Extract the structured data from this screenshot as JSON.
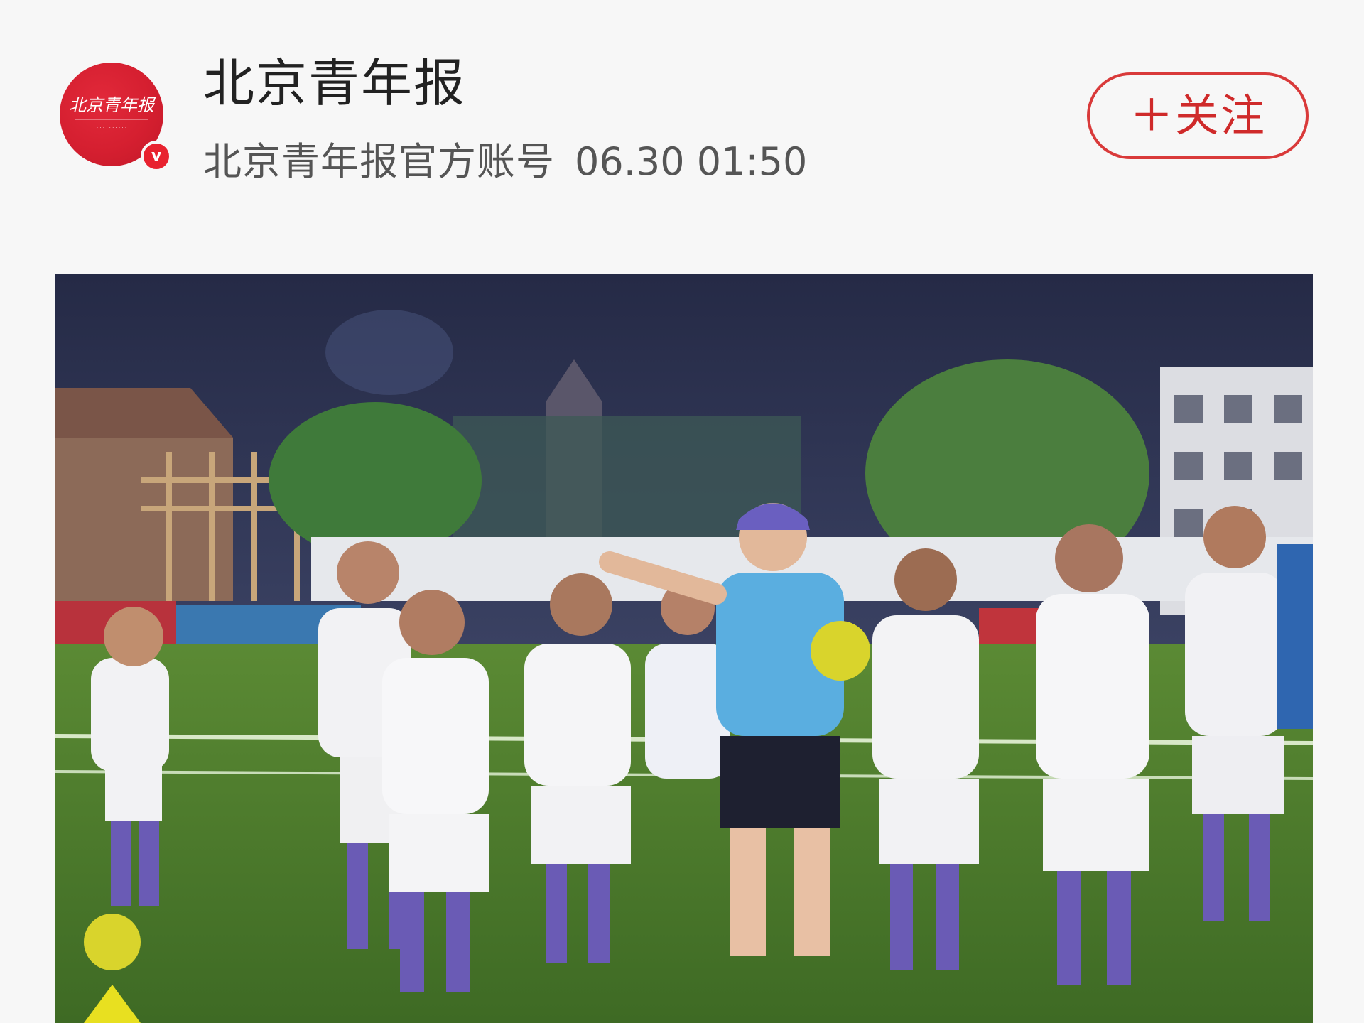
{
  "header": {
    "avatar": {
      "icon": "newspaper-logo-icon",
      "logo_text": "北京青年报",
      "color": "#d51f30"
    },
    "verified_badge": {
      "label": "v",
      "color": "#e8222f"
    },
    "account_name": "北京青年报",
    "account_desc": "北京青年报官方账号",
    "timestamp": "06.30 01:50",
    "follow_button": {
      "label": "＋关注",
      "color": "#cf2a2a"
    }
  },
  "article": {
    "photo": {
      "icon": "photo-youth-football-team-coach",
      "colors": {
        "sky": "#2b3151",
        "pitch": "#4f7a2e",
        "kit": "#f2f2f4",
        "coach_shirt": "#5aaee0"
      }
    }
  }
}
